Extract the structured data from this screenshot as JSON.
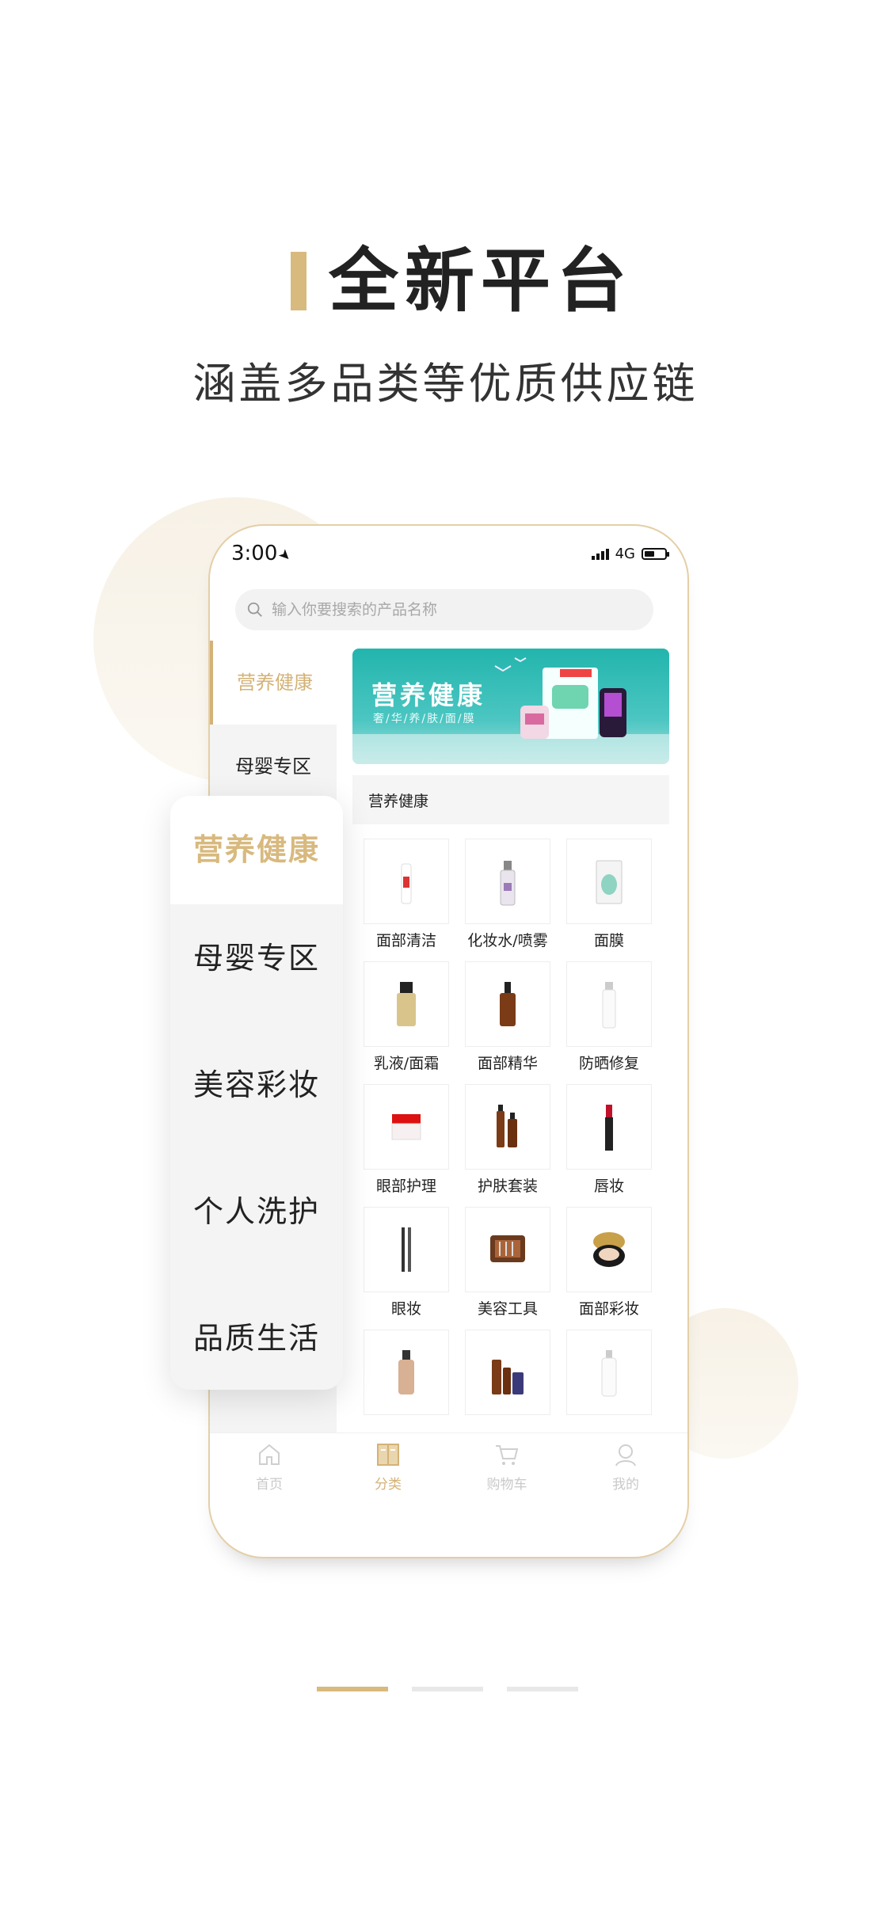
{
  "headline": {
    "title": "全新平台",
    "subtitle": "涵盖多品类等优质供应链"
  },
  "colors": {
    "accent": "#d8b97e",
    "teal_banner": "#22b5ad"
  },
  "phone": {
    "status": {
      "time": "3:00",
      "network": "4G",
      "location_icon": "location-arrow-icon",
      "battery_level": 0.5
    },
    "search": {
      "placeholder": "输入你要搜索的产品名称"
    },
    "left_nav": [
      {
        "label": "营养健康",
        "active": true
      },
      {
        "label": "母婴专区",
        "active": false
      }
    ],
    "banner": {
      "title": "营养健康",
      "subtitle": "奢/华/养/肤/面/膜"
    },
    "section_title": "营养健康",
    "products": [
      {
        "label": "面部清洁",
        "icon": "cleanser-tube-icon"
      },
      {
        "label": "化妆水/喷雾",
        "icon": "toner-bottle-icon"
      },
      {
        "label": "面膜",
        "icon": "face-mask-icon"
      },
      {
        "label": "乳液/面霜",
        "icon": "cream-jar-icon"
      },
      {
        "label": "面部精华",
        "icon": "serum-bottle-icon"
      },
      {
        "label": "防晒修复",
        "icon": "sunscreen-tube-icon"
      },
      {
        "label": "眼部护理",
        "icon": "eye-cream-jar-icon"
      },
      {
        "label": "护肤套装",
        "icon": "skincare-set-icon"
      },
      {
        "label": "唇妆",
        "icon": "lipstick-icon"
      },
      {
        "label": "眼妆",
        "icon": "eyeliner-icon"
      },
      {
        "label": "美容工具",
        "icon": "beauty-tools-icon"
      },
      {
        "label": "面部彩妆",
        "icon": "cushion-compact-icon"
      },
      {
        "label": "",
        "icon": "foundation-bottle-icon"
      },
      {
        "label": "",
        "icon": "serum-set-icon"
      },
      {
        "label": "",
        "icon": "lotion-bottle-icon"
      }
    ],
    "tabbar": [
      {
        "label": "首页",
        "icon": "home-icon",
        "active": false
      },
      {
        "label": "分类",
        "icon": "category-icon",
        "active": true
      },
      {
        "label": "购物车",
        "icon": "cart-icon",
        "active": false
      },
      {
        "label": "我的",
        "icon": "user-icon",
        "active": false
      }
    ]
  },
  "popout": [
    {
      "label": "营养健康",
      "active": true
    },
    {
      "label": "母婴专区",
      "active": false
    },
    {
      "label": "美容彩妆",
      "active": false
    },
    {
      "label": "个人洗护",
      "active": false
    },
    {
      "label": "品质生活",
      "active": false
    }
  ],
  "pager": {
    "count": 3,
    "active_index": 0
  }
}
